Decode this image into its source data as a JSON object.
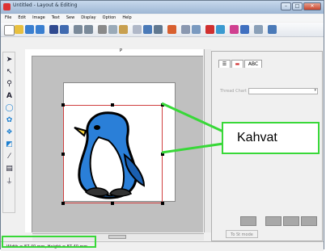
{
  "window": {
    "title": "Untitled - Layout & Editing",
    "buttons": [
      "minimize",
      "maximize",
      "close"
    ]
  },
  "menu": {
    "items": [
      "File",
      "Edit",
      "Image",
      "Text",
      "Sew",
      "Display",
      "Option",
      "Help"
    ]
  },
  "toolbar": {
    "icons": [
      "new-file-icon",
      "open-folder-icon",
      "import-icon",
      "import-alt-icon",
      "save-icon",
      "save-as-icon",
      "undo-icon",
      "redo-icon",
      "cut-icon",
      "copy-icon",
      "paste-icon",
      "duplicate-icon",
      "group-icon",
      "rotate-icon",
      "pencil-icon",
      "font-icon",
      "text-abc-icon",
      "image-icon",
      "photo-icon",
      "sew-icon",
      "color-wheel-icon",
      "stitch-order-icon",
      "zoom-icon"
    ]
  },
  "tools": {
    "icons": [
      "select-arrow-icon",
      "point-edit-icon",
      "zoom-tool-icon",
      "text-tool-icon",
      "shape-tool-icon",
      "stitch-tool-icon",
      "outline-tool-icon",
      "fill-tool-icon",
      "line-tool-icon",
      "ruler-tool-icon",
      "manual-punch-icon"
    ]
  },
  "ruler": {
    "mark": "P"
  },
  "panel": {
    "tabs": [
      {
        "label": ""
      },
      {
        "label": ""
      },
      {
        "label": "ABC"
      }
    ],
    "thread_chart_label": "Thread Chart",
    "thread_chart_value": "",
    "to_stitch_label": "To St mode"
  },
  "status": {
    "text": "Width = 87.40 mm, Height = 87.40 mm"
  },
  "callout": {
    "label": "Kahvat"
  },
  "colors": {
    "accent_green": "#38d838",
    "selection_red": "#d04040",
    "penguin_blue": "#2a7fd8"
  }
}
